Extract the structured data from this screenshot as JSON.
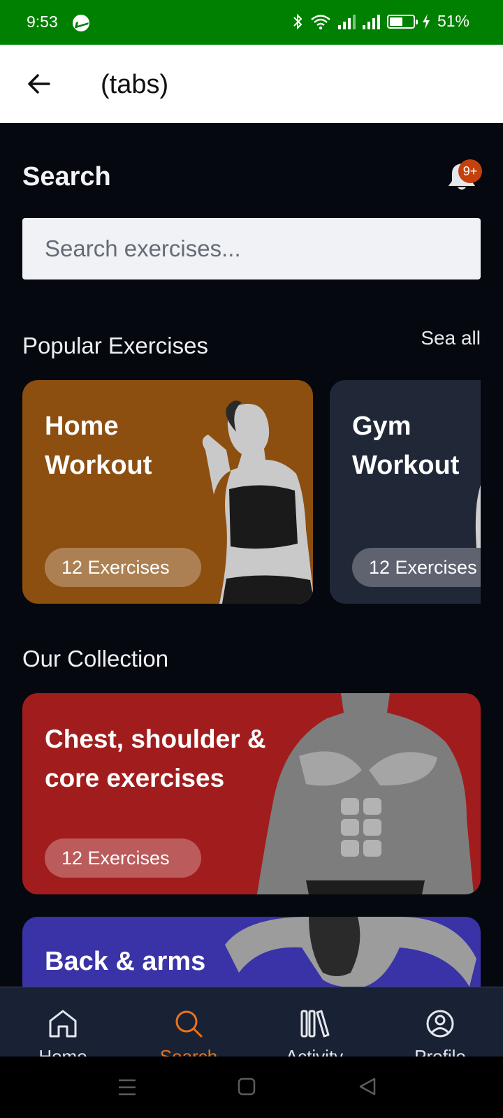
{
  "status_bar": {
    "time": "9:53",
    "battery": "51%"
  },
  "app_bar": {
    "title": "(tabs)"
  },
  "header": {
    "title": "Search",
    "notification_badge": "9+"
  },
  "search": {
    "placeholder": "Search exercises..."
  },
  "popular": {
    "title": "Popular Exercises",
    "see_all": "Sea all",
    "cards": [
      {
        "title_line1": "Home",
        "title_line2": "Workout",
        "count": "12 Exercises",
        "color": "#8c4f10"
      },
      {
        "title_line1": "Gym",
        "title_line2": "Workout",
        "count": "12 Exercises",
        "color": "#202838"
      }
    ]
  },
  "collection": {
    "title": "Our Collection",
    "cards": [
      {
        "title_line1": "Chest, shoulder &",
        "title_line2": "core exercises",
        "count": "12 Exercises",
        "color": "#a11d1d"
      },
      {
        "title_line1": "Back & arms",
        "color": "#3a33a8"
      }
    ]
  },
  "bottom_nav": {
    "items": [
      {
        "label": "Home",
        "icon": "home-icon"
      },
      {
        "label": "Search",
        "icon": "search-icon",
        "active": true
      },
      {
        "label": "Activity",
        "icon": "library-icon"
      },
      {
        "label": "Profile",
        "icon": "profile-icon"
      }
    ],
    "active_color": "#e9731c"
  }
}
